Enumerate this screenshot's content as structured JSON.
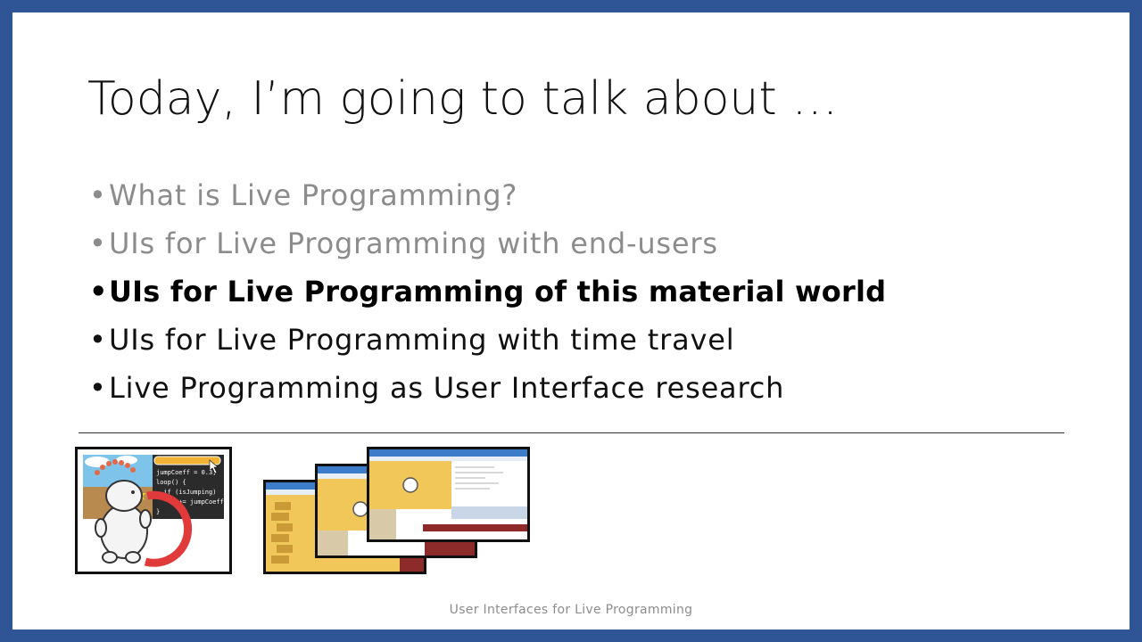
{
  "slide": {
    "title": "Today, I’m going to talk about …",
    "bullets": [
      {
        "text": "What is Live Programming?",
        "state": "past"
      },
      {
        "text": "UIs for Live Programming with end-users",
        "state": "past"
      },
      {
        "text": "UIs for Live Programming of this material world",
        "state": "current"
      },
      {
        "text": "UIs for Live Programming with time travel",
        "state": "upcoming"
      },
      {
        "text": "Live Programming as User Interface research",
        "state": "upcoming"
      }
    ],
    "footer": "User Interfaces for Live Programming",
    "thumbnail_code": [
      "jumpCoeff = 0.3;",
      "loop() {",
      "  if (isJumping)",
      "    y += jumpCoeff*v;",
      "}"
    ]
  },
  "colors": {
    "frame": "#2f5597",
    "past_bullet": "#8c8c8c",
    "current_bullet": "#000000"
  }
}
